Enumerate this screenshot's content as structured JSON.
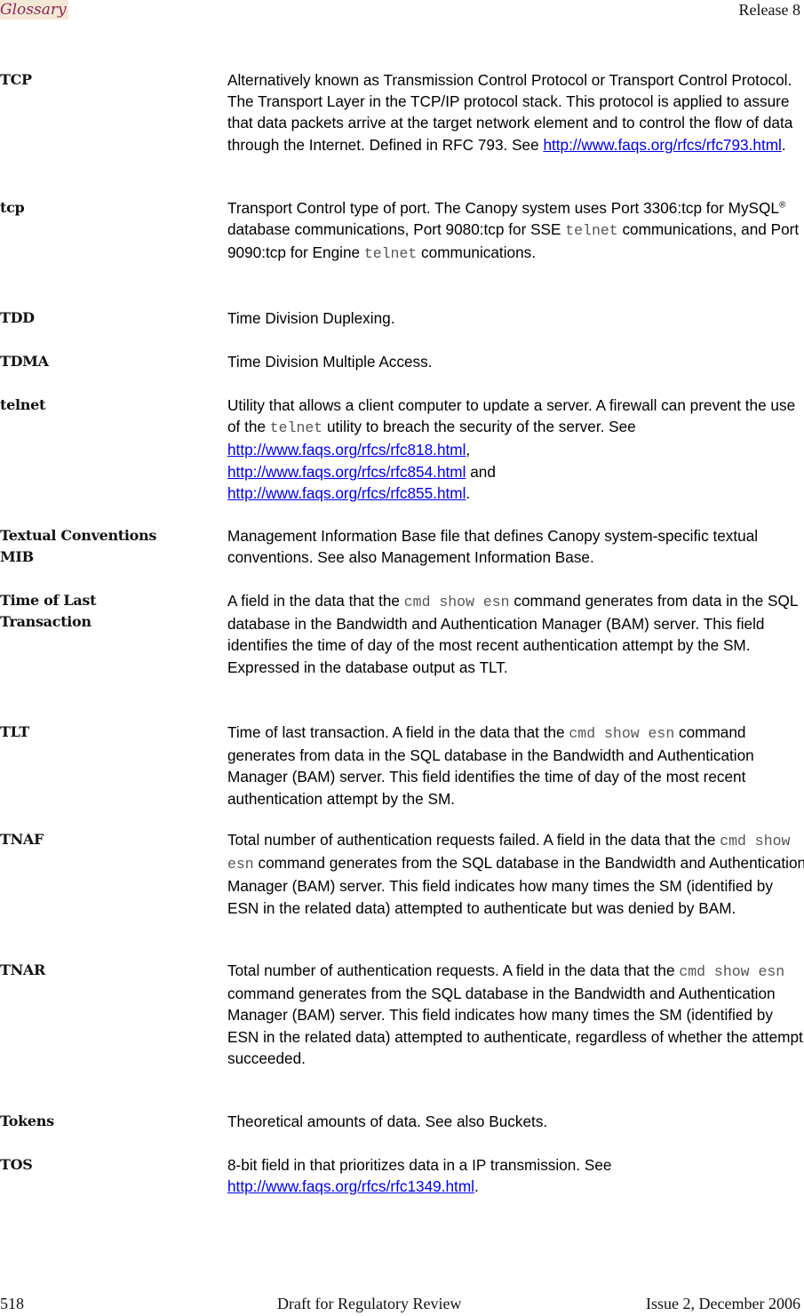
{
  "header": {
    "section": "Glossary",
    "release": "Release 8"
  },
  "footer": {
    "page_number": "518",
    "center": "Draft for Regulatory Review",
    "issue": "Issue 2, December 2006"
  },
  "entries": [
    {
      "term": "TCP",
      "def": {
        "text1": "Alternatively known as Transmission Control Protocol or Transport Control Protocol. The Transport Layer in the TCP/IP protocol stack. This protocol is applied to assure that data packets arrive at the target network element and to control the flow of data through the Internet. Defined in RFC 793. See ",
        "link1": "http://www.faqs.org/rfcs/rfc793.html",
        "text2": "."
      }
    },
    {
      "term": "tcp",
      "def": {
        "text1": "Transport Control type of port. The Canopy system uses Port 3306:tcp for MySQL",
        "sup": "®",
        "text2": " database communications, Port 9080:tcp for SSE ",
        "code1": "telnet",
        "text3": " communications, and Port 9090:tcp for Engine ",
        "code2": "telnet",
        "text4": " communications."
      }
    },
    {
      "term": "TDD",
      "def": {
        "text1": "Time Division Duplexing."
      }
    },
    {
      "term": "TDMA",
      "def": {
        "text1": "Time Division Multiple Access."
      }
    },
    {
      "term": "telnet",
      "def": {
        "text1": "Utility that allows a client computer to update a server. A firewall can prevent the use of the ",
        "code1": "telnet",
        "text2": " utility to breach the security of the server. See ",
        "link1": "http://www.faqs.org/rfcs/rfc818.html",
        "text3": ", ",
        "link2": "http://www.faqs.org/rfcs/rfc854.html",
        "text4": " and ",
        "link3": "http://www.faqs.org/rfcs/rfc855.html",
        "text5": "."
      }
    },
    {
      "term_line1": "Textual Conventions",
      "term_line2": "MIB",
      "def": {
        "text1": "Management Information Base file that defines Canopy system-specific textual conventions. See also Management Information Base."
      }
    },
    {
      "term_line1": "Time of Last",
      "term_line2": "Transaction",
      "def": {
        "text1": "A field in the data that the ",
        "code1": "cmd show esn",
        "text2": " command generates from data in the SQL database in the Bandwidth and Authentication Manager (BAM) server. This field identifies the time of day of the most recent authentication attempt by the SM. Expressed in the database output as TLT."
      }
    },
    {
      "term": "TLT",
      "def": {
        "text1": "Time of last transaction. A field in the data that the ",
        "code1": "cmd show esn",
        "text2": " command generates from data in the SQL database in the Bandwidth and Authentication Manager (BAM) server. This field identifies the time of day of the most recent authentication attempt by the SM."
      }
    },
    {
      "term": "TNAF",
      "def": {
        "text1": "Total number of authentication requests failed. A field in the data that the ",
        "code1": "cmd show esn",
        "text2": " command generates from the SQL database in the Bandwidth and Authentication Manager (BAM) server. This field indicates how many times the SM (identified by ESN in the related data) attempted to authenticate but was denied by BAM."
      }
    },
    {
      "term": "TNAR",
      "def": {
        "text1": "Total number of authentication requests. A field in the data that the ",
        "code1": "cmd show esn",
        "text2": " command generates from the SQL database in the Bandwidth and Authentication Manager (BAM) server. This field indicates how many times the SM (identified by ESN in the related data) attempted to authenticate, regardless of whether the attempt succeeded."
      }
    },
    {
      "term": "Tokens",
      "def": {
        "text1": "Theoretical amounts of data. See also Buckets."
      }
    },
    {
      "term": "TOS",
      "def": {
        "text1": "8-bit field in that prioritizes data in a IP transmission. See ",
        "link1": "http://www.faqs.org/rfcs/rfc1349.html",
        "text2": "."
      }
    }
  ]
}
